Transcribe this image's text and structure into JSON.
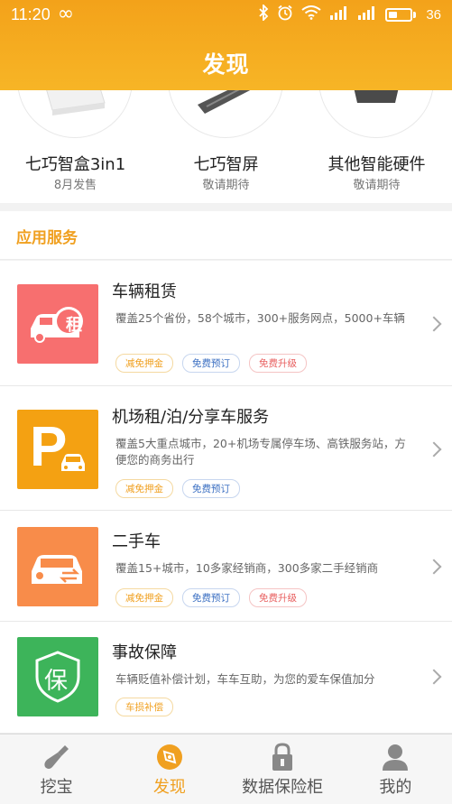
{
  "status_bar": {
    "time": "11:20",
    "battery_level": "36"
  },
  "header": {
    "title": "发现"
  },
  "hardware": [
    {
      "name": "七巧智盒3in1",
      "sub": "8月发售"
    },
    {
      "name": "七巧智屏",
      "sub": "敬请期待"
    },
    {
      "name": "其他智能硬件",
      "sub": "敬请期待"
    }
  ],
  "section": {
    "title": "应用服务"
  },
  "services": [
    {
      "title": "车辆租赁",
      "desc": "覆盖25个省份，58个城市，300+服务网点，5000+车辆",
      "icon": "car-rent-icon",
      "tags": [
        "减免押金",
        "免费预订",
        "免费升级"
      ],
      "icon_color": "#f76f6f"
    },
    {
      "title": "机场租/泊/分享车服务",
      "desc": "覆盖5大重点城市，20+机场专属停车场、高铁服务站，方便您的商务出行",
      "icon": "parking-icon",
      "icon_text": "P",
      "tags": [
        "减免押金",
        "免费预订"
      ],
      "icon_color": "#f4a112"
    },
    {
      "title": "二手车",
      "desc": "覆盖15+城市，10多家经销商，300多家二手经销商",
      "icon": "used-car-icon",
      "tags": [
        "减免押金",
        "免费预订",
        "免费升级"
      ],
      "icon_color": "#f88c4a"
    },
    {
      "title": "事故保障",
      "desc": "车辆贬值补偿计划，车车互助，为您的爱车保值加分",
      "icon": "shield-icon",
      "icon_text": "保",
      "tags": [
        "车损补偿"
      ],
      "icon_color": "#3db45a"
    }
  ],
  "rent_badge": "租",
  "nav": [
    {
      "label": "挖宝",
      "icon": "shovel-icon",
      "active": false
    },
    {
      "label": "发现",
      "icon": "compass-icon",
      "active": true
    },
    {
      "label": "数据保险柜",
      "icon": "lock-icon",
      "active": false
    },
    {
      "label": "我的",
      "icon": "user-icon",
      "active": false
    }
  ],
  "colors": {
    "accent": "#f0a020",
    "header": "#f3a21a"
  }
}
